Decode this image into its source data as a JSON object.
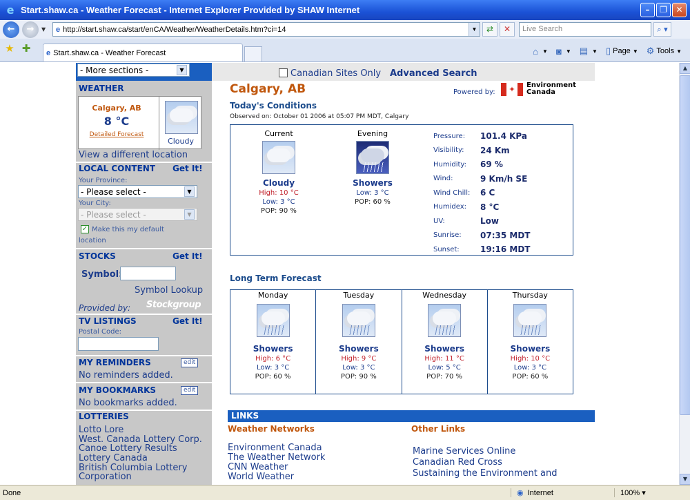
{
  "window": {
    "title": "Start.shaw.ca - Weather Forecast - Internet Explorer Provided by SHAW Internet"
  },
  "address": {
    "url": "http://start.shaw.ca/start/enCA/Weather/WeatherDetails.htm?ci=14",
    "search_placeholder": "Live Search"
  },
  "tab": {
    "label": "Start.shaw.ca - Weather Forecast"
  },
  "commands": {
    "page": "Page",
    "tools": "Tools"
  },
  "status": {
    "text": "Done",
    "zone": "Internet",
    "zoom": "100%"
  },
  "sidebar": {
    "more_sections": "- More sections -",
    "weather": {
      "heading": "WEATHER",
      "city": "Calgary, AB",
      "temp": "8 °C",
      "detailed": "Detailed Forecast",
      "cond": "Cloudy",
      "change": "View a different location"
    },
    "local": {
      "heading": "LOCAL CONTENT",
      "getit": "Get It!",
      "province_label": "Your Province:",
      "province_value": "- Please select -",
      "city_label": "Your City:",
      "city_value": "- Please select -",
      "default_label": "Make this my default",
      "default_label2": "location"
    },
    "stocks": {
      "heading": "STOCKS",
      "getit": "Get It!",
      "symbol_label": "Symbol:",
      "lookup": "Symbol Lookup",
      "provided": "Provided by:",
      "provider": "Stockgroup"
    },
    "tv": {
      "heading": "TV LISTINGS",
      "getit": "Get It!",
      "postal_label": "Postal Code:"
    },
    "reminders": {
      "heading": "MY REMINDERS",
      "edit": "edit",
      "empty": "No reminders added."
    },
    "bookmarks": {
      "heading": "MY BOOKMARKS",
      "edit": "edit",
      "empty": "No bookmarks added."
    },
    "lotteries": {
      "heading": "LOTTERIES",
      "items": [
        "Lotto Lore",
        "West. Canada Lottery Corp.",
        "Canoe Lottery Results",
        "Lottery Canada",
        "British Columbia Lottery",
        "Corporation"
      ]
    }
  },
  "topsearch": {
    "canadian": "Canadian Sites Only",
    "advanced": "Advanced Search"
  },
  "main": {
    "city": "Calgary, AB",
    "powered": "Powered by:",
    "ec_line1": "Environment",
    "ec_line2": "Canada",
    "today_heading": "Today's Conditions",
    "observed": "Observed on: October 01 2006 at 05:07 PM MDT, Calgary",
    "current": {
      "label": "Current",
      "cond": "Cloudy",
      "high": "High: 10 °C",
      "low": "Low: 3 °C",
      "pop": "POP: 90 %"
    },
    "evening": {
      "label": "Evening",
      "cond": "Showers",
      "low": "Low: 3 °C",
      "pop": "POP: 60 %"
    },
    "details": [
      {
        "label": "Pressure:",
        "value": "101.4 KPa"
      },
      {
        "label": "Visibility:",
        "value": "24 Km"
      },
      {
        "label": "Humidity:",
        "value": "69 %"
      },
      {
        "label": "Wind:",
        "value": "9 Km/h SE"
      },
      {
        "label": "Wind Chill:",
        "value": "6 C"
      },
      {
        "label": "Humidex:",
        "value": "8 °C"
      },
      {
        "label": "UV:",
        "value": "Low"
      },
      {
        "label": "Sunrise:",
        "value": "07:35 MDT"
      },
      {
        "label": "Sunset:",
        "value": "19:16 MDT"
      }
    ],
    "long_heading": "Long Term Forecast",
    "long": [
      {
        "day": "Monday",
        "cond": "Showers",
        "high": "High: 6 °C",
        "low": "Low: 3 °C",
        "pop": "POP: 60 %"
      },
      {
        "day": "Tuesday",
        "cond": "Showers",
        "high": "High: 9 °C",
        "low": "Low: 3 °C",
        "pop": "POP: 90 %"
      },
      {
        "day": "Wednesday",
        "cond": "Showers",
        "high": "High: 11 °C",
        "low": "Low: 5 °C",
        "pop": "POP: 70 %"
      },
      {
        "day": "Thursday",
        "cond": "Showers",
        "high": "High: 10 °C",
        "low": "Low: 3 °C",
        "pop": "POP: 60 %"
      }
    ],
    "links_heading": "LINKS",
    "weather_networks": {
      "heading": "Weather Networks",
      "items": [
        "Environment Canada",
        "The Weather Network",
        "CNN Weather",
        "World Weather"
      ]
    },
    "other_links": {
      "heading": "Other Links",
      "items": [
        "Marine Services Online",
        "Canadian Red Cross",
        "Sustaining the Environment and"
      ]
    }
  }
}
